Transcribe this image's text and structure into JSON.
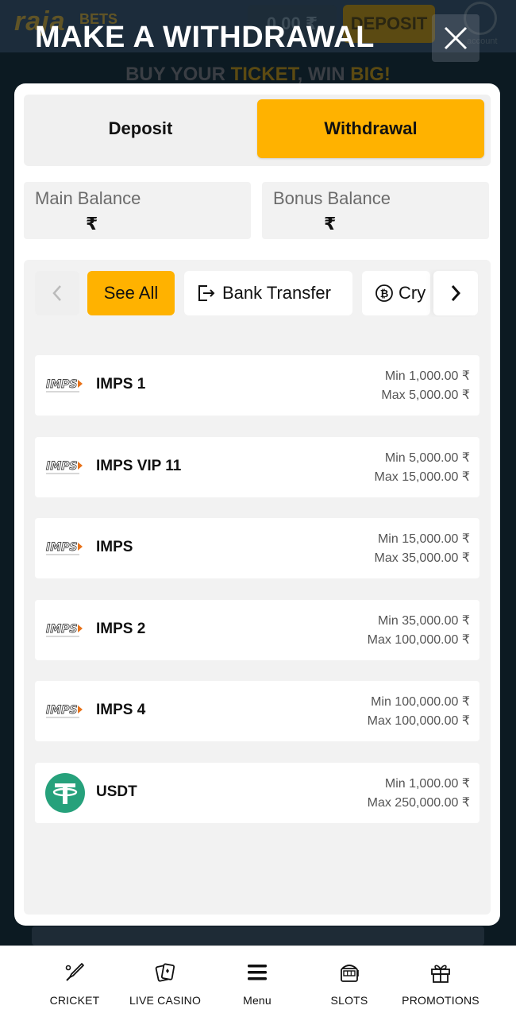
{
  "background": {
    "logo": "raja",
    "logo_sub": "BETS",
    "balance": "0.00 ₹",
    "deposit": "DEPOSIT",
    "user_label": "account",
    "banner_a": "BUY YOUR ",
    "banner_b": "TICKET",
    "banner_c": ", WIN ",
    "banner_d": "BIG!"
  },
  "modal": {
    "title": "MAKE A WITHDRAWAL"
  },
  "tabs": {
    "deposit": "Deposit",
    "withdrawal": "Withdrawal",
    "active": "Withdrawal"
  },
  "balances": {
    "main": {
      "label": "Main Balance",
      "value": "₹"
    },
    "bonus": {
      "label": "Bonus Balance",
      "value": "₹"
    }
  },
  "filters": {
    "see_all": "See All",
    "bank_transfer": "Bank Transfer",
    "crypto": "Cry"
  },
  "methods": [
    {
      "name": "IMPS 1",
      "min": "Min 1,000.00 ₹",
      "max": "Max 5,000.00 ₹",
      "logo": "imps-logo"
    },
    {
      "name": "IMPS VIP 11",
      "min": "Min 5,000.00 ₹",
      "max": "Max 15,000.00 ₹",
      "logo": "imps-logo"
    },
    {
      "name": "IMPS",
      "min": "Min 15,000.00 ₹",
      "max": "Max 35,000.00 ₹",
      "logo": "imps-logo"
    },
    {
      "name": "IMPS 2",
      "min": "Min 35,000.00 ₹",
      "max": "Max 100,000.00 ₹",
      "logo": "imps-logo"
    },
    {
      "name": "IMPS 4",
      "min": "Min 100,000.00 ₹",
      "max": "Max 100,000.00 ₹",
      "logo": "imps-logo"
    },
    {
      "name": "USDT",
      "min": "Min 1,000.00 ₹",
      "max": "Max 250,000.00 ₹",
      "logo": "tether-logo"
    }
  ],
  "imps_logo_text": "IMPS",
  "bottom_nav": [
    {
      "label": "CRICKET",
      "icon": "cricket-bat-icon"
    },
    {
      "label": "LIVE CASINO",
      "icon": "cards-icon"
    },
    {
      "label": "Menu",
      "icon": "menu-icon"
    },
    {
      "label": "SLOTS",
      "icon": "slot-machine-icon"
    },
    {
      "label": "PROMOTIONS",
      "icon": "gift-icon"
    }
  ],
  "colors": {
    "accent": "#ffb200",
    "tether": "#26a17b",
    "overlay": "#0c1a22"
  }
}
